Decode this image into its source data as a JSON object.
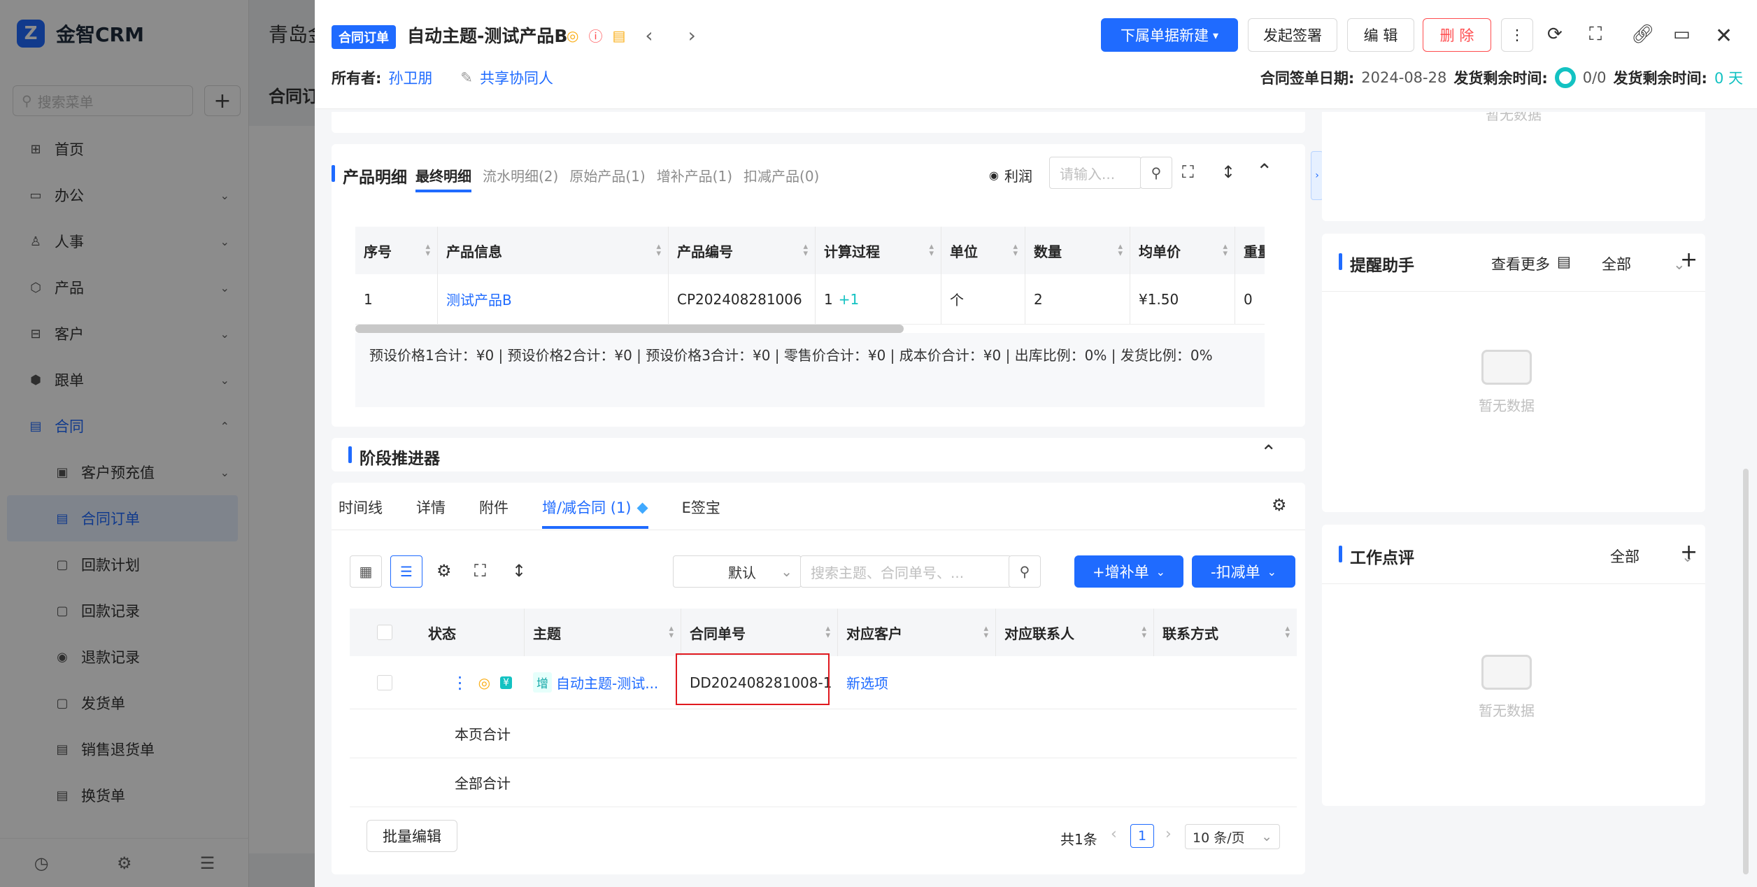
{
  "sidebar": {
    "brand": "金智CRM",
    "search_placeholder": "搜索菜单",
    "items": [
      {
        "label": "首页",
        "icon": "home-icon"
      },
      {
        "label": "办公",
        "icon": "office-icon"
      },
      {
        "label": "人事",
        "icon": "people-icon"
      },
      {
        "label": "产品",
        "icon": "product-icon"
      },
      {
        "label": "客户",
        "icon": "customer-icon"
      },
      {
        "label": "跟单",
        "icon": "follow-icon"
      },
      {
        "label": "合同",
        "icon": "contract-icon"
      }
    ],
    "subitems": [
      {
        "label": "客户预充值"
      },
      {
        "label": "合同订单"
      },
      {
        "label": "回款计划"
      },
      {
        "label": "回款记录"
      },
      {
        "label": "退款记录"
      },
      {
        "label": "发货单"
      },
      {
        "label": "销售退货单"
      },
      {
        "label": "换货单"
      }
    ]
  },
  "background": {
    "top_text": "青岛金",
    "tab": "合同订"
  },
  "header": {
    "type_badge": "合同订单",
    "title": "自动主题-测试产品B",
    "owner_label": "所有者:",
    "owner_name": "孙卫朋",
    "share_label": "共享协同人",
    "btn_new": "下属单据新建",
    "btn_sign": "发起签署",
    "btn_edit": "编 辑",
    "btn_delete": "删 除",
    "sign_date_label": "合同签单日期:",
    "sign_date": "2024-08-28",
    "ship_remain_label": "发货剩余时间:",
    "ship_ratio": "0/0",
    "ship_remain_label2": "发货剩余时间:",
    "ship_days": "0 天"
  },
  "product": {
    "title": "产品明细",
    "tabs": [
      "最终明细",
      "流水明细(2)",
      "原始产品(1)",
      "增补产品(1)",
      "扣减产品(0)"
    ],
    "profit": "利润",
    "search_placeholder": "请输入...",
    "columns": [
      "序号",
      "产品信息",
      "产品编号",
      "计算过程",
      "单位",
      "数量",
      "均单价",
      "重量"
    ],
    "row": {
      "no": "1",
      "name": "测试产品B",
      "code": "CP202408281006",
      "calc": "1",
      "calc_plus": "+1",
      "unit": "个",
      "qty": "2",
      "price": "¥1.50",
      "weight": "0"
    },
    "summary": "预设价格1合计：¥0 |   预设价格2合计：¥0 |   预设价格3合计：¥0 |   零售价合计：¥0 |   成本价合计：¥0 |   出库比例：0% |   发货比例：0%"
  },
  "stage": {
    "title": "阶段推进器"
  },
  "related": {
    "tabs": [
      "时间线",
      "详情",
      "附件",
      "增/减合同 (1)",
      "E签宝"
    ],
    "sort_default": "默认",
    "search_placeholder": "搜索主题、合同单号、...",
    "btn_add": "+增补单",
    "btn_minus": "-扣减单",
    "columns": [
      "状态",
      "主题",
      "合同单号",
      "对应客户",
      "对应联系人",
      "联系方式"
    ],
    "row": {
      "tag": "增",
      "subject": "自动主题-测试...",
      "number": "DD202408281008-1",
      "customer": "新选项"
    },
    "page_total": "本页合计",
    "all_total": "全部合计",
    "batch_edit": "批量编辑",
    "total": "共1条",
    "page": "1",
    "page_size": "10 条/页"
  },
  "right": {
    "top_empty": "暂无数据",
    "reminder_title": "提醒助手",
    "view_more": "查看更多",
    "reminder_filter": "全部",
    "reminder_empty": "暂无数据",
    "review_title": "工作点评",
    "review_filter": "全部",
    "review_empty": "暂无数据"
  }
}
